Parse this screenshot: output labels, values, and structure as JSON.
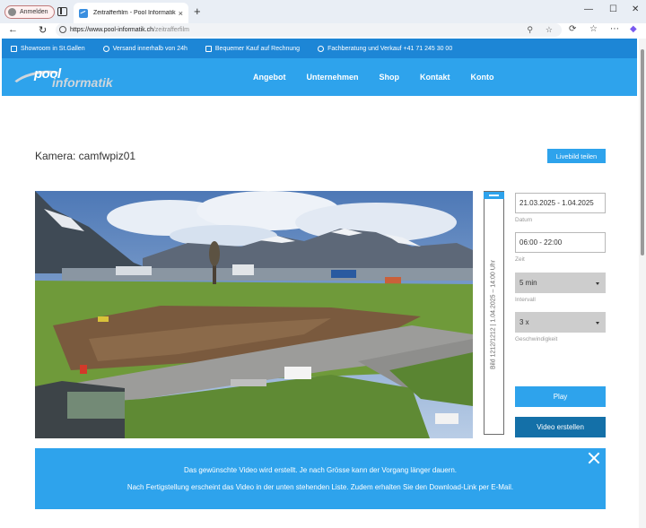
{
  "browser": {
    "profile_label": "Anmelden",
    "tab_title": "Zeitrafferfilm - Pool Informatik",
    "url_host": "https://www.pool-informatik.ch",
    "url_path": "/zeitrafferfilm",
    "new_tab_glyph": "+",
    "close_glyph": "×"
  },
  "infobar": {
    "items": [
      {
        "icon": "store-icon",
        "label": "Showroom in St.Gallen"
      },
      {
        "icon": "clock-icon",
        "label": "Versand innerhalb von 24h"
      },
      {
        "icon": "bag-icon",
        "label": "Bequemer Kauf auf Rechnung"
      },
      {
        "icon": "headset-icon",
        "label": "Fachberatung und Verkauf +41 71 245 30 00"
      }
    ]
  },
  "header": {
    "logo_top": "pool",
    "logo_bottom": "informatik",
    "nav": [
      "Angebot",
      "Unternehmen",
      "Shop",
      "Kontakt",
      "Konto"
    ]
  },
  "camera": {
    "title": "Kamera: camfwpiz01",
    "share_label": "Livebild teilen",
    "slider_label": "Bild 1212/1212 | 1.04.2025 – 14:00 Uhr"
  },
  "form": {
    "date_value": "21.03.2025 - 1.04.2025",
    "date_label": "Datum",
    "time_value": "06:00 - 22:00",
    "time_label": "Zeit",
    "interval_value": "5 min",
    "interval_label": "Intervall",
    "speed_value": "3 x",
    "speed_label": "Geschwindigkeit",
    "play_label": "Play",
    "video_label": "Video erstellen"
  },
  "notice": {
    "line1": "Das gewünschte Video wird erstellt. Je nach Grösse kann der Vorgang länger dauern.",
    "line2": "Nach Fertigstellung erscheint das Video in der unten stehenden Liste. Zudem erhalten Sie den Download-Link per E-Mail."
  },
  "colors": {
    "primary": "#2ea3ec",
    "dark_button": "#1470a8",
    "infobar": "#1d86d6"
  }
}
